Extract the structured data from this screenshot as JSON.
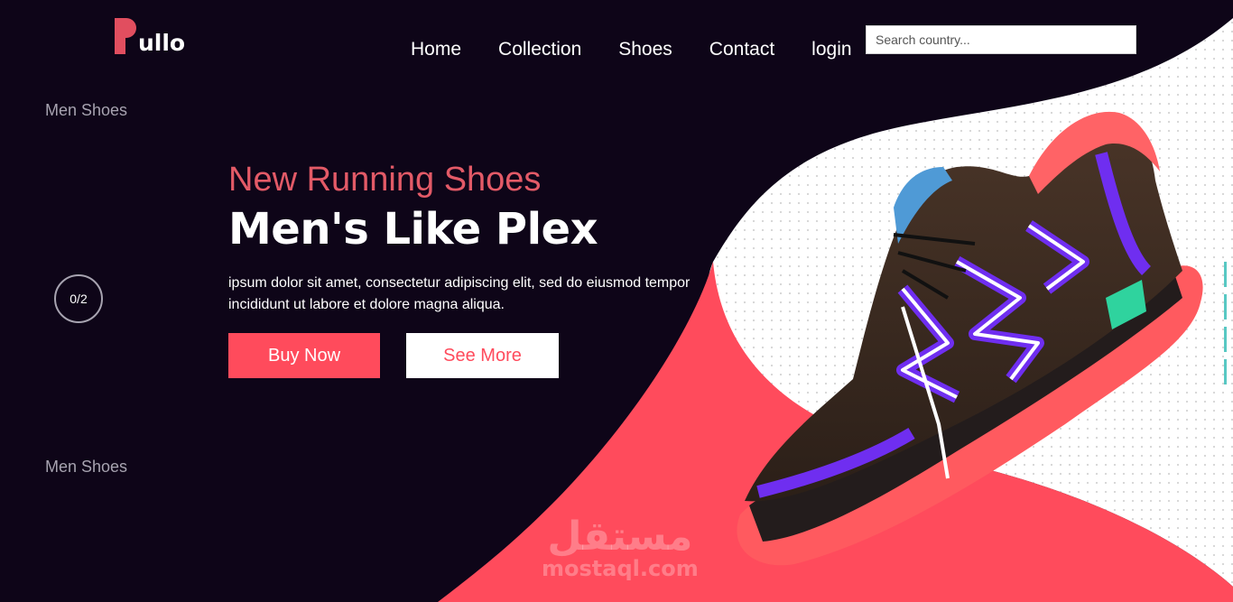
{
  "brand": {
    "name": "ullo"
  },
  "nav": [
    {
      "label": "Home"
    },
    {
      "label": "Collection"
    },
    {
      "label": "Shoes"
    },
    {
      "label": "Contact"
    },
    {
      "label": "login"
    }
  ],
  "search": {
    "placeholder": "Search country...",
    "value": ""
  },
  "side": {
    "label_top": "Men Shoes",
    "label_bottom": "Men Shoes",
    "counter": "0/2"
  },
  "hero": {
    "subtitle": "New Running Shoes",
    "title": "Men's Like Plex",
    "description": "ipsum dolor sit amet, consectetur adipiscing elit, sed do eiusmod tempor incididunt ut labore et dolore magna aliqua.",
    "buy_label": "Buy Now",
    "more_label": "See More",
    "image_icon": "running-shoe-image"
  },
  "watermark": {
    "arabic": "مستقل",
    "latin": "mostaql.com"
  },
  "colors": {
    "background": "#0e0518",
    "accent": "#ff4b5c",
    "subtitle": "#e35a67",
    "panel": "#ffffff",
    "slider_mark": "#58c8c3"
  }
}
